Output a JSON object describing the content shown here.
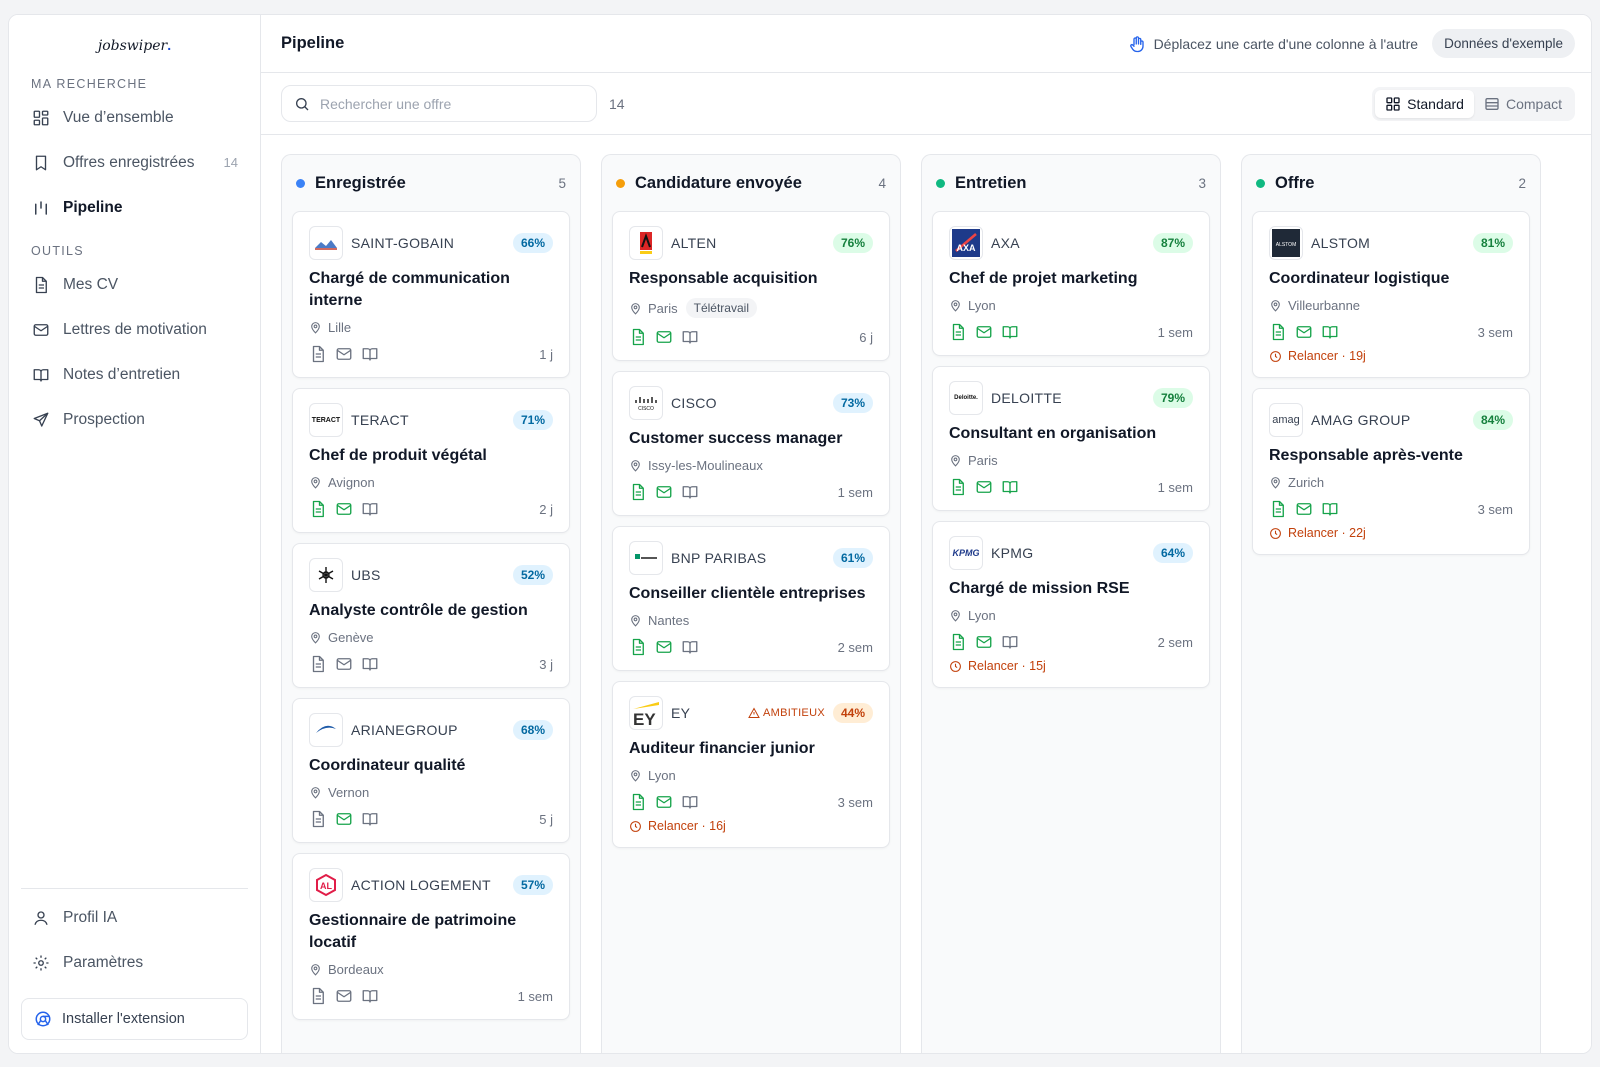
{
  "app": {
    "logo_text": "jobswiper",
    "logo_suffix": "."
  },
  "sidebar": {
    "section_search": "MA RECHERCHE",
    "section_tools": "OUTILS",
    "items": [
      {
        "label": "Vue d’ensemble",
        "icon": "grid-icon",
        "count": ""
      },
      {
        "label": "Offres enregistrées",
        "icon": "bookmark-icon",
        "count": "14"
      },
      {
        "label": "Pipeline",
        "icon": "columns-icon",
        "count": "",
        "active": true
      }
    ],
    "tools": [
      {
        "label": "Mes CV",
        "icon": "document-icon"
      },
      {
        "label": "Lettres de motivation",
        "icon": "mail-icon"
      },
      {
        "label": "Notes d’entretien",
        "icon": "book-icon"
      },
      {
        "label": "Prospection",
        "icon": "send-icon"
      }
    ],
    "bottom": [
      {
        "label": "Profil IA",
        "icon": "user-icon"
      },
      {
        "label": "Paramètres",
        "icon": "gear-icon"
      }
    ],
    "extension_label": "Installer l'extension"
  },
  "header": {
    "title": "Pipeline",
    "hint": "Déplacez une carte d'une colonne à l'autre",
    "sample_button": "Données d'exemple"
  },
  "toolbar": {
    "search_placeholder": "Rechercher une offre",
    "result_count": "14",
    "view_standard": "Standard",
    "view_compact": "Compact"
  },
  "columns": [
    {
      "name": "Enregistrée",
      "count": "5",
      "color": "#3b82f6",
      "cards": [
        {
          "company": "SAINT-GOBAIN",
          "logo": "saint-gobain",
          "pct": "66%",
          "tone": "b",
          "role": "Chargé de communication interne",
          "location": "Lille",
          "tag": "",
          "docs": [
            false,
            false,
            false
          ],
          "age": "1 j",
          "remind": ""
        },
        {
          "company": "TERACT",
          "logo": "teract",
          "pct": "71%",
          "tone": "b",
          "role": "Chef de produit végétal",
          "location": "Avignon",
          "tag": "",
          "docs": [
            true,
            true,
            false
          ],
          "age": "2 j",
          "remind": ""
        },
        {
          "company": "UBS",
          "logo": "ubs",
          "pct": "52%",
          "tone": "b",
          "role": "Analyste contrôle de gestion",
          "location": "Genève",
          "tag": "",
          "docs": [
            false,
            false,
            false
          ],
          "age": "3 j",
          "remind": ""
        },
        {
          "company": "ARIANEGROUP",
          "logo": "arianegroup",
          "pct": "68%",
          "tone": "b",
          "role": "Coordinateur qualité",
          "location": "Vernon",
          "tag": "",
          "docs": [
            false,
            true,
            false
          ],
          "age": "5 j",
          "remind": ""
        },
        {
          "company": "ACTION LOGEMENT",
          "logo": "action-logement",
          "pct": "57%",
          "tone": "b",
          "role": "Gestionnaire de patrimoine locatif",
          "location": "Bordeaux",
          "tag": "",
          "docs": [
            false,
            false,
            false
          ],
          "age": "1 sem",
          "remind": ""
        }
      ]
    },
    {
      "name": "Candidature envoyée",
      "count": "4",
      "color": "#f59e0b",
      "cards": [
        {
          "company": "ALTEN",
          "logo": "alten",
          "pct": "76%",
          "tone": "g",
          "role": "Responsable acquisition",
          "location": "Paris",
          "tag": "Télétravail",
          "docs": [
            true,
            true,
            false
          ],
          "age": "6 j",
          "remind": ""
        },
        {
          "company": "CISCO",
          "logo": "cisco",
          "pct": "73%",
          "tone": "b",
          "role": "Customer success manager",
          "location": "Issy-les-Moulineaux",
          "tag": "",
          "docs": [
            true,
            true,
            false
          ],
          "age": "1 sem",
          "remind": ""
        },
        {
          "company": "BNP PARIBAS",
          "logo": "bnp",
          "pct": "61%",
          "tone": "b",
          "role": "Conseiller clientèle entreprises",
          "location": "Nantes",
          "tag": "",
          "docs": [
            true,
            true,
            false
          ],
          "age": "2 sem",
          "remind": ""
        },
        {
          "company": "EY",
          "logo": "ey",
          "pct": "44%",
          "tone": "o",
          "flag": "AMBITIEUX",
          "role": "Auditeur financier junior",
          "location": "Lyon",
          "tag": "",
          "docs": [
            true,
            true,
            false
          ],
          "age": "3 sem",
          "remind": "Relancer · 16j"
        }
      ]
    },
    {
      "name": "Entretien",
      "count": "3",
      "color": "#10b981",
      "cards": [
        {
          "company": "AXA",
          "logo": "axa",
          "pct": "87%",
          "tone": "g",
          "role": "Chef de projet marketing",
          "location": "Lyon",
          "tag": "",
          "docs": [
            true,
            true,
            true
          ],
          "age": "1 sem",
          "remind": ""
        },
        {
          "company": "DELOITTE",
          "logo": "deloitte",
          "pct": "79%",
          "tone": "g",
          "role": "Consultant en organisation",
          "location": "Paris",
          "tag": "",
          "docs": [
            true,
            true,
            true
          ],
          "age": "1 sem",
          "remind": ""
        },
        {
          "company": "KPMG",
          "logo": "kpmg",
          "pct": "64%",
          "tone": "b",
          "role": "Chargé de mission RSE",
          "location": "Lyon",
          "tag": "",
          "docs": [
            true,
            true,
            false
          ],
          "age": "2 sem",
          "remind": "Relancer · 15j"
        }
      ]
    },
    {
      "name": "Offre",
      "count": "2",
      "color": "#10b981",
      "cards": [
        {
          "company": "ALSTOM",
          "logo": "alstom",
          "pct": "81%",
          "tone": "g",
          "role": "Coordinateur logistique",
          "location": "Villeurbanne",
          "tag": "",
          "docs": [
            true,
            true,
            true
          ],
          "age": "3 sem",
          "remind": "Relancer · 19j"
        },
        {
          "company": "AMAG GROUP",
          "logo": "amag",
          "pct": "84%",
          "tone": "g",
          "role": "Responsable après-vente",
          "location": "Zurich",
          "tag": "",
          "docs": [
            true,
            true,
            true
          ],
          "age": "3 sem",
          "remind": "Relancer · 22j"
        }
      ]
    }
  ]
}
